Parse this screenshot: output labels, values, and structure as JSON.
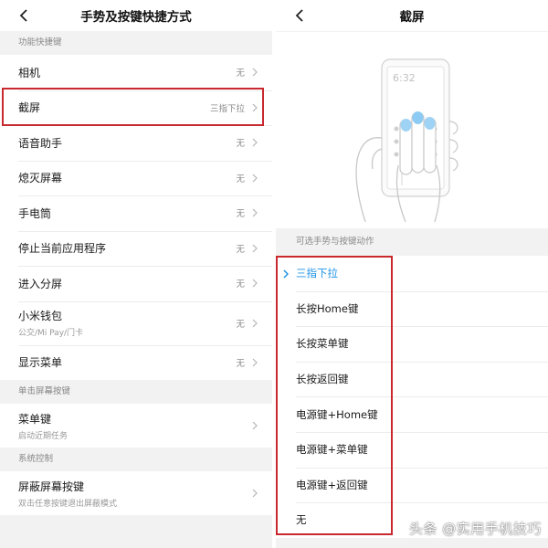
{
  "left": {
    "title": "手势及按键快捷方式",
    "sections": [
      {
        "label": "功能快捷键",
        "items": [
          {
            "label": "相机",
            "value": "无"
          },
          {
            "label": "截屏",
            "value": "三指下拉"
          },
          {
            "label": "语音助手",
            "value": "无"
          },
          {
            "label": "熄灭屏幕",
            "value": "无"
          },
          {
            "label": "手电筒",
            "value": "无"
          },
          {
            "label": "停止当前应用程序",
            "value": "无"
          },
          {
            "label": "进入分屏",
            "value": "无"
          },
          {
            "label": "小米钱包",
            "sub": "公交/Mi Pay/门卡",
            "value": "无"
          },
          {
            "label": "显示菜单",
            "value": "无"
          }
        ]
      },
      {
        "label": "单击屏幕按键",
        "items": [
          {
            "label": "菜单键",
            "sub": "启动近期任务"
          }
        ]
      },
      {
        "label": "系统控制",
        "items": [
          {
            "label": "屏蔽屏幕按键",
            "sub": "双击任意按键退出屏蔽模式"
          }
        ]
      }
    ]
  },
  "right": {
    "title": "截屏",
    "phone_time": "6:32",
    "section_label": "可选手势与按键动作",
    "options": [
      "三指下拉",
      "长按Home键",
      "长按菜单键",
      "长按返回键",
      "电源键+Home键",
      "电源键+菜单键",
      "电源键+返回键",
      "无"
    ],
    "selected_index": 0
  },
  "watermark": "头条 @实用手机技巧",
  "colors": {
    "accent": "#1e93e6",
    "highlight_box": "#c8292f",
    "background": "#f2f2f2"
  },
  "icons": {
    "back": "chevron-left-icon",
    "row_arrow": "chevron-right-icon",
    "selected_mark": "chevron-right-icon"
  }
}
